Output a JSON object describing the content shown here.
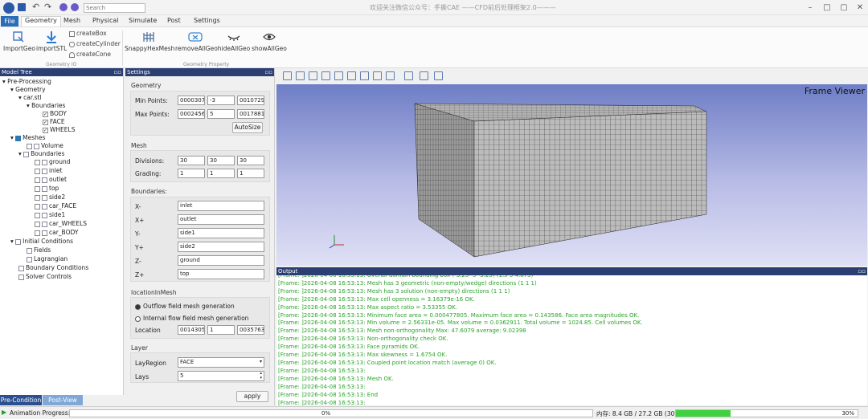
{
  "window": {
    "title": "欢迎关注微信公众号：手撕CAE ——CFD前后处理框架2.0———"
  },
  "menu": {
    "file": "File",
    "tabs": [
      "Geometry",
      "Mesh",
      "Physical",
      "Simulate",
      "Post",
      "Settings"
    ],
    "search_placeholder": "Search"
  },
  "ribbon": {
    "import_geo": "ImportGeo",
    "import_stl": "importSTL",
    "create_box": "createBox",
    "create_cylinder": "createCylinder",
    "create_cone": "createCone",
    "group_io": "Geometry IO",
    "snappy": "SnappyHexMesh",
    "remove_all": "removeAllGeo",
    "hide_all": "hideAllGeo",
    "show_all": "showAllGeo",
    "group_prop": "Geometry Property"
  },
  "tree": {
    "title": "Model Tree",
    "pre": "Pre-Processing",
    "geometry": "Geometry",
    "car": "car.stl",
    "boundaries": "Boundaries",
    "body": "BODY",
    "face": "FACE",
    "wheels": "WHEELS",
    "meshes": "Meshes",
    "volume": "Volume",
    "mboundaries": "Boundaries",
    "b": [
      "ground",
      "inlet",
      "outlet",
      "top",
      "side2",
      "car_FACE",
      "side1",
      "car_WHEELS",
      "car_BODY"
    ],
    "initial": "Initial Conditions",
    "fields": "Fields",
    "lagrangian": "Lagrangian",
    "bc": "Boundary Conditions",
    "solver": "Solver Controls"
  },
  "settings": {
    "title": "Settings",
    "geometry": "Geometry",
    "min_points": "Min Points:",
    "max_points": "Max Points:",
    "min": [
      "0000307",
      "-3",
      "0010729"
    ],
    "max": [
      "0002456",
      "5",
      "0017881"
    ],
    "autosize": "AutoSize",
    "mesh": "Mesh",
    "divisions": "Divisions:",
    "grading": "Grading:",
    "div": [
      "30",
      "30",
      "30"
    ],
    "grad": [
      "1",
      "1",
      "1"
    ],
    "boundaries": "Boundaries:",
    "blabels": [
      "X-",
      "X+",
      "Y-",
      "Y+",
      "Z-",
      "Z+"
    ],
    "bvalues": [
      "inlet",
      "outlet",
      "side1",
      "side2",
      "ground",
      "top"
    ],
    "location_in_mesh": "locationInMesh",
    "outflow": "Outflow field  mesh generation",
    "internal": "Internal flow field mesh generation",
    "location": "Location",
    "loc": [
      "0014305",
      "1",
      "0035763"
    ],
    "layer": "Layer",
    "lay_region": "LayRegion",
    "lay_region_value": "FACE",
    "lays": "Lays",
    "lays_value": "5",
    "apply": "apply"
  },
  "viewer": {
    "label": "Frame Viewer"
  },
  "output": {
    "title": "Output",
    "lines": [
      "[Frame: ]2026-04-08 16:53:13: Overall domain bounding box (-3.25 -5 -3.25) (1.5 5 4.875)",
      "[Frame: ]2026-04-08 16:53:13: Mesh has 3 geometric (non-empty/wedge) directions (1 1 1)",
      "[Frame: ]2026-04-08 16:53:13: Mesh has 3 solution (non-empty) directions (1 1 1)",
      "[Frame: ]2026-04-08 16:53:13: Max cell openness = 3.16379e-16 OK.",
      "[Frame: ]2026-04-08 16:53:13: Max aspect ratio = 3.53355 OK.",
      "[Frame: ]2026-04-08 16:53:13: Minimum face area = 0.000477805. Maximum face area = 0.143586. Face area magnitudes OK.",
      "[Frame: ]2026-04-08 16:53:13: Min volume = 2.56331e-05. Max volume = 0.0362911. Total volume = 1024.85. Cell volumes OK.",
      "[Frame: ]2026-04-08 16:53:13: Mesh non-orthogonality Max: 47.6079 average: 9.02398",
      "[Frame: ]2026-04-08 16:53:13: Non-orthogonality check OK.",
      "[Frame: ]2026-04-08 16:53:13: Face pyramids OK.",
      "[Frame: ]2026-04-08 16:53:13: Max skewness = 1.6754 OK.",
      "[Frame: ]2026-04-08 16:53:13: Coupled point location match (average 0) OK.",
      "[Frame: ]2026-04-08 16:53:13:",
      "[Frame: ]2026-04-08 16:53:13: Mesh OK.",
      "[Frame: ]2026-04-08 16:53:13:",
      "[Frame: ]2026-04-08 16:53:13: End",
      "[Frame: ]2026-04-08 16:53:13:"
    ]
  },
  "bottom_tabs": {
    "pre": "Pre-Condition",
    "post": "Post-View"
  },
  "status": {
    "animation": "Animation Progress:",
    "anim_value": "0%",
    "anim_fraction": 0,
    "memory": "内存: 8.4 GB / 27.2 GB (30%)",
    "mem_value": "30%",
    "mem_fraction": 0.3
  },
  "colors": {
    "accent": "#2b3f73",
    "file": "#2a6cb8",
    "output_text": "#2aa32a",
    "progress": "#3ed23e"
  }
}
